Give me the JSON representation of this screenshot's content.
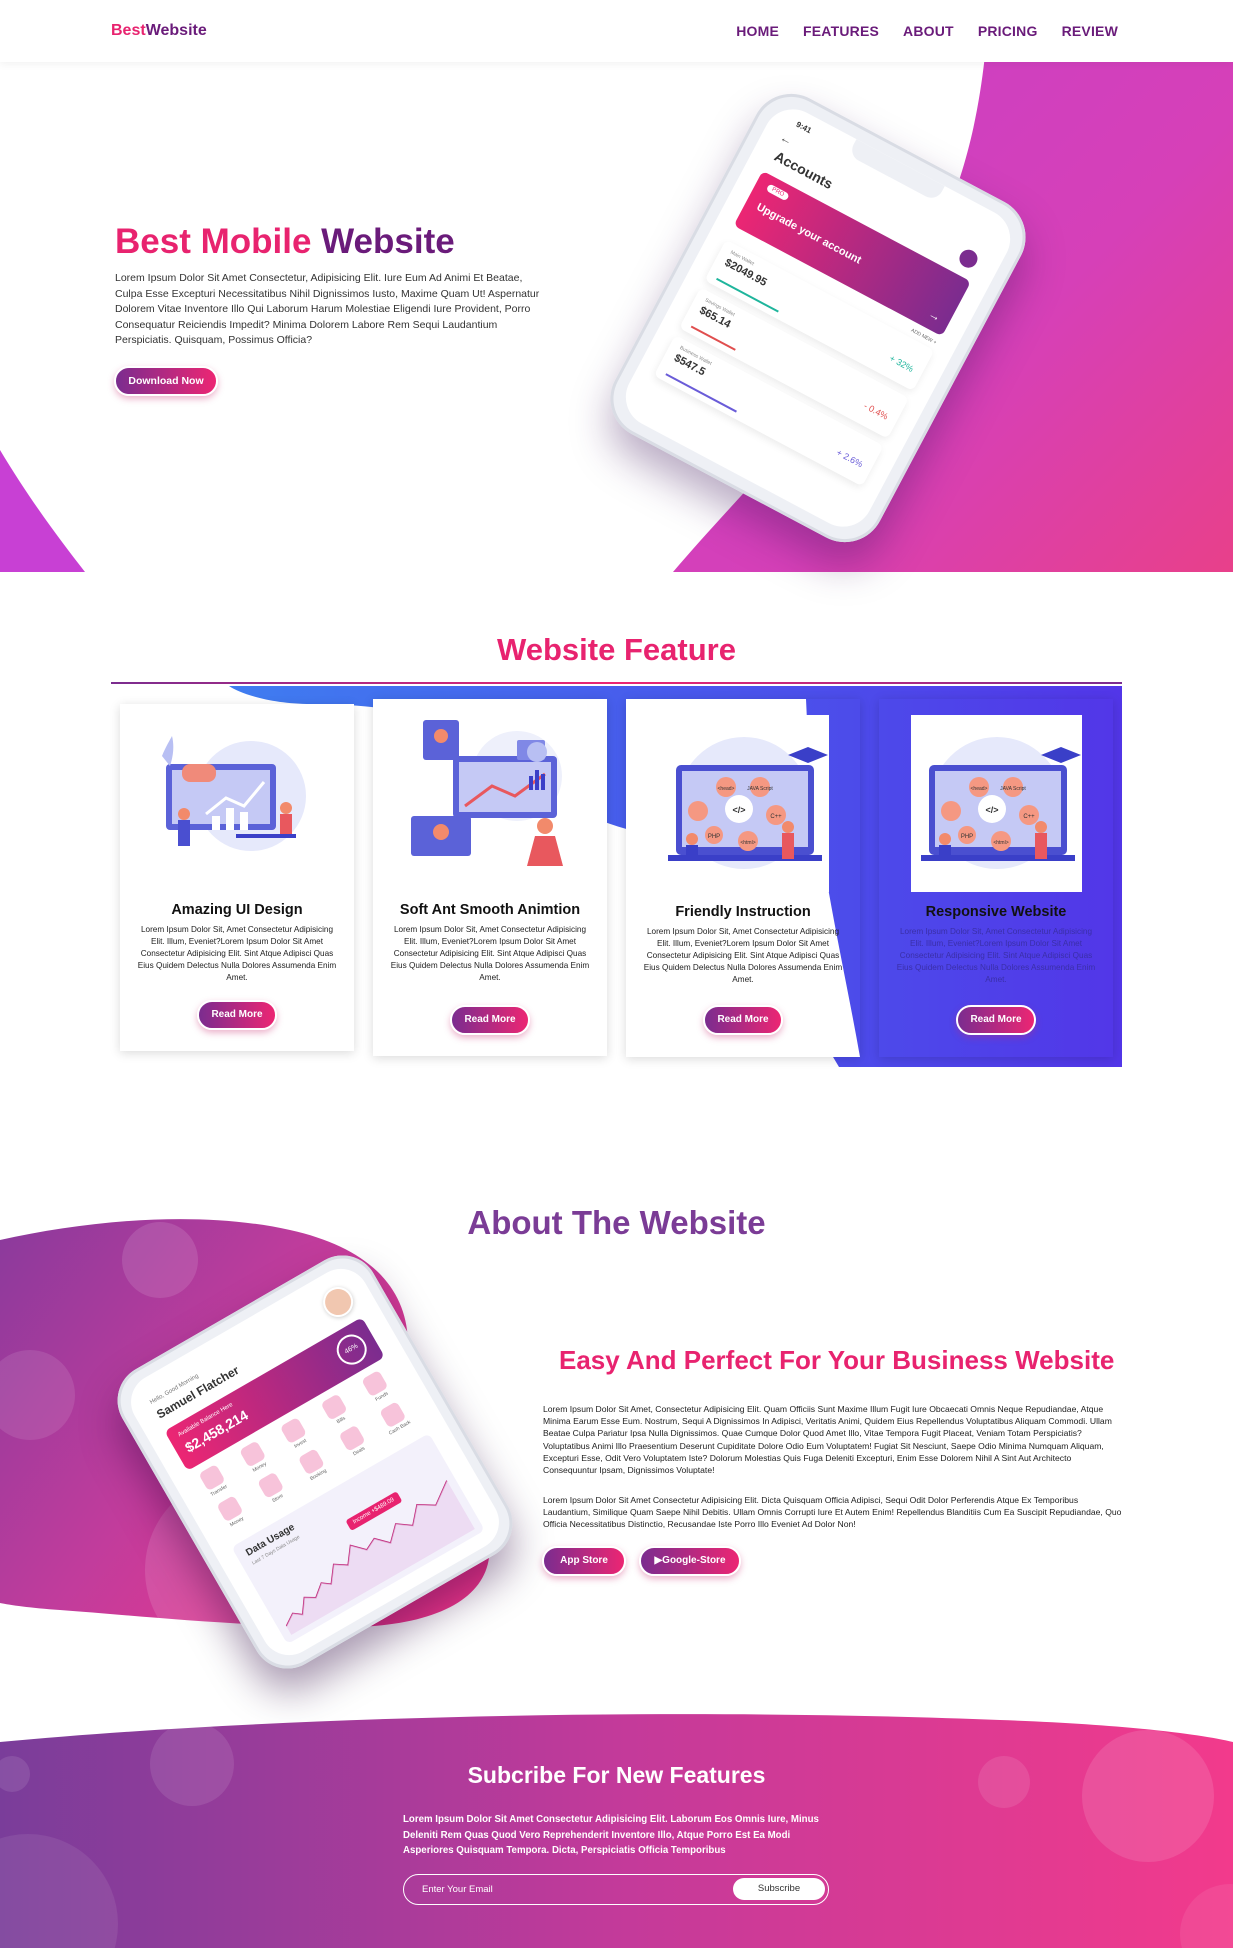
{
  "nav": {
    "logo_a": "Best",
    "logo_b": "Website",
    "links": [
      "HOME",
      "FEATURES",
      "ABOUT",
      "PRICING",
      "REVIEW"
    ]
  },
  "hero": {
    "title_a": "Best Mobile ",
    "title_b": "Website",
    "text": "Lorem Ipsum Dolor Sit Amet Consectetur, Adipisicing Elit. Iure Eum Ad Animi Et Beatae, Culpa Esse Excepturi Necessitatibus Nihil Dignissimos Iusto, Maxime Quam Ut! Aspernatur Dolorem Vitae Inventore Illo Qui Laborum Harum Molestiae Eligendi Iure Provident, Porro Consequatur Reiciendis Impedit? Minima Dolorem Labore Rem Sequi Laudantium Perspiciatis. Quisquam, Possimus Officia?",
    "button": "Download Now",
    "phone": {
      "time": "9:41",
      "back": "←",
      "title": "Accounts",
      "badge": "PRO",
      "banner": "Upgrade your account",
      "add_new": "ADD NEW  +",
      "wallets": [
        {
          "label": "Main Wallet",
          "value": "$2049.95",
          "pct": "+ 32%",
          "color": "#1fb59c"
        },
        {
          "label": "Savings Wallet",
          "value": "$65.14",
          "pct": "- 0.4%",
          "color": "#e04e4e"
        },
        {
          "label": "Business Wallet",
          "value": "$547.5",
          "pct": "+ 2.6%",
          "color": "#6a5cd8"
        }
      ]
    }
  },
  "features": {
    "title": "Website Feature",
    "cards": [
      {
        "title": "Amazing UI Design",
        "text": "Lorem Ipsum Dolor Sit, Amet Consectetur Adipisicing Elit. Illum, Eveniet?Lorem Ipsum Dolor Sit Amet Consectetur Adipisicing Elit. Sint Atque Adipisci Quas Eius Quidem Delectus Nulla Dolores Assumenda Enim Amet.",
        "button": "Read More"
      },
      {
        "title": "Soft Ant Smooth Animtion",
        "text": "Lorem Ipsum Dolor Sit, Amet Consectetur Adipisicing Elit. Illum, Eveniet?Lorem Ipsum Dolor Sit Amet Consectetur Adipisicing Elit. Sint Atque Adipisci Quas Eius Quidem Delectus Nulla Dolores Assumenda Enim Amet.",
        "button": "Read More"
      },
      {
        "title": "Friendly Instruction",
        "text": "Lorem Ipsum Dolor Sit, Amet Consectetur Adipisicing Elit. Illum, Eveniet?Lorem Ipsum Dolor Sit Amet Consectetur Adipisicing Elit. Sint Atque Adipisci Quas Eius Quidem Delectus Nulla Dolores Assumenda Enim Amet.",
        "button": "Read More"
      },
      {
        "title": "Responsive Website",
        "text": "Lorem Ipsum Dolor Sit, Amet Consectetur Adipisicing Elit. Illum, Eveniet?Lorem Ipsum Dolor Sit Amet Consectetur Adipisicing Elit. Sint Atque Adipisci Quas Eius Quidem Delectus Nulla Dolores Assumenda Enim Amet.",
        "button": "Read More"
      }
    ],
    "code_labels": [
      "<head>",
      "JAVA Script",
      "</>",
      "C++",
      "PHP",
      "<html>"
    ]
  },
  "about": {
    "title": "About The Website",
    "subtitle": "Easy And Perfect For Your Business Website",
    "p1": "Lorem Ipsum Dolor Sit Amet, Consectetur Adipisicing Elit. Quam Officiis Sunt Maxime Illum Fugit Iure Obcaecati Omnis Neque Repudiandae, Atque Minima Earum Esse Eum. Nostrum, Sequi A Dignissimos In Adipisci, Veritatis Animi, Quidem Eius Repellendus Voluptatibus Aliquam Commodi. Ullam Beatae Culpa Pariatur Ipsa Nulla Dignissimos. Quae Cumque Dolor Quod Amet Illo, Vitae Tempora Fugit Placeat, Veniam Totam Perspiciatis? Voluptatibus Animi Illo Praesentium Deserunt Cupiditate Dolore Odio Eum Voluptatem! Fugiat Sit Nesciunt, Saepe Odio Minima Numquam Aliquam, Excepturi Esse, Odit Vero Voluptatem Iste? Dolorum Molestias Quis Fuga Deleniti Excepturi, Enim Esse Dolorem Nihil A Sint Aut Architecto Consequuntur Ipsam, Dignissimos Voluptate!",
    "p2": "Lorem Ipsum Dolor Sit Amet Consectetur Adipisicing Elit. Dicta Quisquam Officia Adipisci, Sequi Odit Dolor Perferendis Atque Ex Temporibus Laudantium, Similique Quam Saepe Nihil Debitis. Ullam Omnis Corrupti Iure Et Autem Enim! Repellendus Blanditiis Cum Ea Suscipit Repudiandae, Quo Officia Necessitatibus Distinctio, Recusandae Iste Porro Illo Eveniet Ad Dolor Non!",
    "btn_app": "App Store",
    "btn_google": "Google-Store",
    "phone": {
      "greeting": "Hello, Good Morning",
      "name": "Samuel Flatcher",
      "balance_label": "Available Balance Here",
      "balance": "$2,458,214",
      "percent": "46%",
      "icons": [
        "Transfer",
        "Money",
        "Invest",
        "Bills",
        "Funds",
        "Money",
        "Store",
        "Booking",
        "Deals",
        "Cash Back"
      ],
      "data_title": "Data Usage",
      "data_sub": "Last 7 Days Data Usage",
      "tooltip_a": "Income",
      "tooltip_b": "+$489.09"
    }
  },
  "subscribe": {
    "title": "Subcribe For New Features",
    "text": "Lorem Ipsum Dolor Sit Amet Consectetur Adipisicing Elit. Laborum Eos Omnis Iure, Minus Deleniti Rem Quas Quod Vero Reprehenderit Inventore Illo, Atque Porro Est Ea Modi Asperiores Quisquam Tempora. Dicta, Perspiciatis Officia Temporibus",
    "placeholder": "Enter Your Email",
    "button": "Subscribe"
  },
  "colors": {
    "pink": "#ec2673",
    "purple": "#7b2c8f",
    "blue": "#4b3be6",
    "magenta": "#c64fd4"
  }
}
